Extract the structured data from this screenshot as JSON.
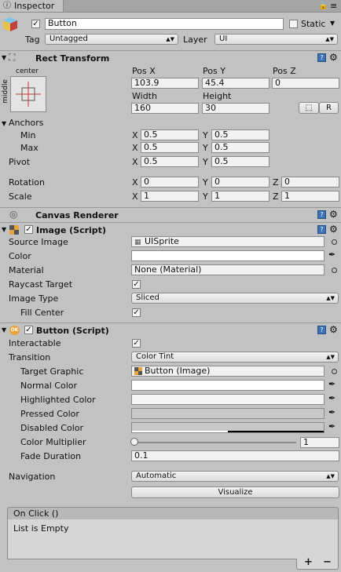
{
  "tab": {
    "title": "Inspector"
  },
  "header": {
    "object_name": "Button",
    "static_label": "Static",
    "tag_label": "Tag",
    "tag_value": "Untagged",
    "layer_label": "Layer",
    "layer_value": "UI"
  },
  "rect": {
    "title": "Rect Transform",
    "anchor_top": "center",
    "anchor_side": "middle",
    "posx_label": "Pos X",
    "posy_label": "Pos Y",
    "posz_label": "Pos Z",
    "posx": "103.9",
    "posy": "45.4",
    "posz": "0",
    "width_label": "Width",
    "height_label": "Height",
    "width": "160",
    "height": "30",
    "r_label": "R",
    "anchors_label": "Anchors",
    "min_label": "Min",
    "max_label": "Max",
    "min_x": "0.5",
    "min_y": "0.5",
    "max_x": "0.5",
    "max_y": "0.5",
    "pivot_label": "Pivot",
    "pivot_x": "0.5",
    "pivot_y": "0.5",
    "rotation_label": "Rotation",
    "rot_x": "0",
    "rot_y": "0",
    "rot_z": "0",
    "scale_label": "Scale",
    "scale_x": "1",
    "scale_y": "1",
    "scale_z": "1",
    "axis_x": "X",
    "axis_y": "Y",
    "axis_z": "Z"
  },
  "canvas_renderer": {
    "title": "Canvas Renderer"
  },
  "image": {
    "title": "Image (Script)",
    "source_image_label": "Source Image",
    "source_image": "UISprite",
    "color_label": "Color",
    "material_label": "Material",
    "material": "None (Material)",
    "raycast_label": "Raycast Target",
    "image_type_label": "Image Type",
    "image_type": "Sliced",
    "fill_center_label": "Fill Center"
  },
  "button": {
    "title": "Button (Script)",
    "icon_text": "OK",
    "interactable_label": "Interactable",
    "transition_label": "Transition",
    "transition": "Color Tint",
    "target_graphic_label": "Target Graphic",
    "target_graphic": "Button (Image)",
    "normal_label": "Normal Color",
    "highlighted_label": "Highlighted Color",
    "pressed_label": "Pressed Color",
    "disabled_label": "Disabled Color",
    "multiplier_label": "Color Multiplier",
    "multiplier": "1",
    "fade_label": "Fade Duration",
    "fade": "0.1",
    "navigation_label": "Navigation",
    "navigation": "Automatic",
    "visualize_label": "Visualize",
    "onclick_title": "On Click ()",
    "onclick_empty": "List is Empty",
    "add_label": "+",
    "remove_label": "−"
  },
  "colors": {
    "normal": "#FFFFFF",
    "highlighted": "#F5F5F5",
    "pressed": "#C8C8C8",
    "disabled": "#C8C8C8",
    "accent": "#3C73B5"
  }
}
